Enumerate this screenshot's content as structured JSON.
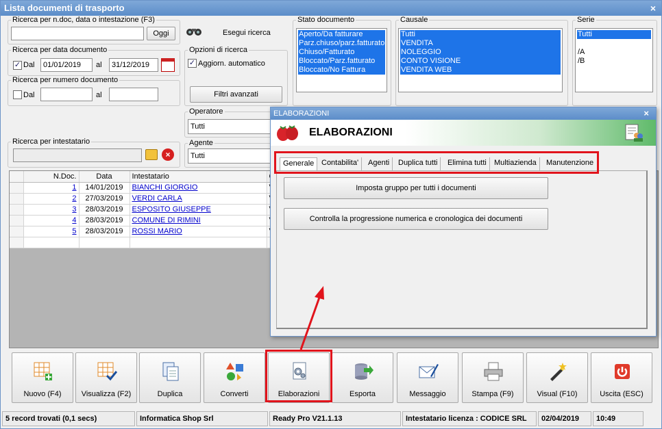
{
  "window": {
    "title": "Lista documenti di trasporto",
    "close": "×"
  },
  "search_ndoc": {
    "legend": "Ricerca per n.doc, data o intestazione (F3)",
    "value": "",
    "today_btn": "Oggi"
  },
  "run_search": {
    "label": "Esegui ricerca"
  },
  "search_date": {
    "legend": "Ricerca per data documento",
    "from_label": "Dal",
    "from_checked": "✓",
    "from": "01/01/2019",
    "to_label": "al",
    "to": "31/12/2019"
  },
  "search_options": {
    "legend": "Opzioni di ricerca",
    "auto_update": "Aggiorn. automatico",
    "auto_checked": "✓",
    "advanced_btn": "Filtri avanzati"
  },
  "search_number": {
    "legend": "Ricerca per numero documento",
    "from_label": "Dal",
    "from": "",
    "to_label": "al",
    "to": ""
  },
  "operator": {
    "legend": "Operatore",
    "value": "Tutti"
  },
  "agent": {
    "legend": "Agente",
    "value": "Tutti"
  },
  "holder": {
    "legend": "Ricerca per intestatario",
    "value": ""
  },
  "doc_status": {
    "legend": "Stato documento",
    "items": [
      "Aperto/Da fatturare",
      "Parz.chiuso/parz.fatturato",
      "Chiuso/Fatturato",
      "Bloccato/Parz.fatturato",
      "Bloccato/No Fattura"
    ]
  },
  "reason": {
    "legend": "Causale",
    "items": [
      "Tutti",
      "VENDITA",
      "NOLEGGIO",
      "CONTO VISIONE",
      "VENDITA WEB"
    ]
  },
  "series": {
    "legend": "Serie",
    "items": [
      "Tutti",
      "",
      "/A",
      "/B"
    ]
  },
  "grid": {
    "headers": [
      "N.Doc.",
      "Data",
      "Intestatario",
      "Cau"
    ],
    "rows": [
      {
        "n": "1",
        "date": "14/01/2019",
        "holder": "BIANCHI GIORGIO",
        "cau": "VEN"
      },
      {
        "n": "2",
        "date": "27/03/2019",
        "holder": "VERDI CARLA",
        "cau": "VEN"
      },
      {
        "n": "3",
        "date": "28/03/2019",
        "holder": "ESPOSITO GIUSEPPE",
        "cau": "VEN"
      },
      {
        "n": "4",
        "date": "28/03/2019",
        "holder": "COMUNE DI RIMINI",
        "cau": "VEN"
      },
      {
        "n": "5",
        "date": "28/03/2019",
        "holder": "ROSSI MARIO",
        "cau": "VEN"
      }
    ]
  },
  "toolbar": {
    "new": "Nuovo (F4)",
    "view": "Visualizza (F2)",
    "duplicate": "Duplica",
    "convert": "Converti",
    "processing": "Elaborazioni",
    "export": "Esporta",
    "message": "Messaggio",
    "print": "Stampa (F9)",
    "visual": "Visual (F10)",
    "exit": "Uscita (ESC)"
  },
  "status": {
    "records": "5 record trovati (0,1 secs)",
    "company": "Informatica Shop Srl",
    "version": "Ready Pro V21.1.13",
    "license": "Intestatario licenza : CODICE SRL",
    "date": "02/04/2019",
    "time": "10:49"
  },
  "dialog": {
    "title": "ELABORAZIONI",
    "heading": "ELABORAZIONI",
    "close": "×",
    "tabs": [
      "Generale",
      "Contabilita'",
      "Agenti",
      "Duplica tutti",
      "Elimina tutti",
      "Multiazienda",
      "Manutenzione"
    ],
    "actions": [
      "Imposta gruppo per tutti i documenti",
      "Controlla la progressione numerica e cronologica dei documenti"
    ]
  },
  "colors": {
    "title_blue": "#5c8dc9",
    "selection": "#1e74e8",
    "highlight_red": "#e1141c",
    "link": "#0000cc"
  }
}
